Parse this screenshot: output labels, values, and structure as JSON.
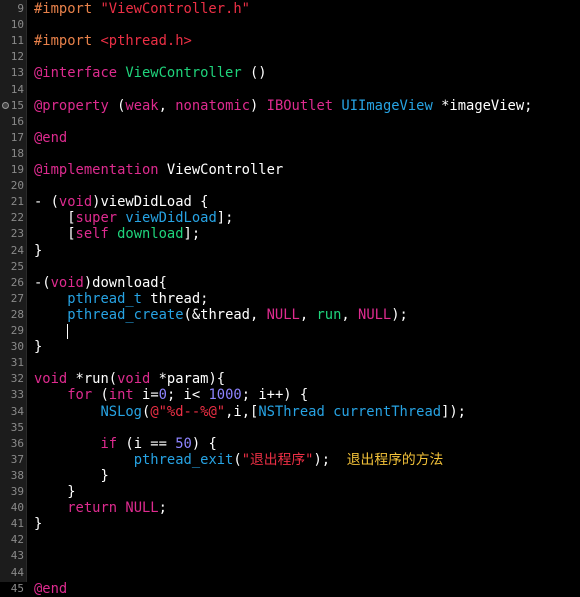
{
  "colors": {
    "keyword": "#de2b8f",
    "preprocessor": "#e8814a",
    "string": "#ec2f45",
    "class": "#1fd47c",
    "type": "#27a3e3",
    "number": "#8e84ff",
    "comment": "#f3c239",
    "background": "#000000"
  },
  "breakpoint_line": 15,
  "caret_line": 29,
  "lines": [
    {
      "n": "9",
      "t": [
        [
          "#import ",
          "pp"
        ],
        [
          "\"ViewController.h\"",
          "s"
        ]
      ]
    },
    {
      "n": "10",
      "t": []
    },
    {
      "n": "11",
      "t": [
        [
          "#import ",
          "pp"
        ],
        [
          "<pthread.h>",
          "s"
        ]
      ]
    },
    {
      "n": "12",
      "t": []
    },
    {
      "n": "13",
      "t": [
        [
          "@interface ",
          "k"
        ],
        [
          "ViewController",
          "c"
        ],
        [
          " ()",
          "p"
        ]
      ]
    },
    {
      "n": "14",
      "t": []
    },
    {
      "n": "15",
      "t": [
        [
          "@property",
          "k"
        ],
        [
          " (",
          "p"
        ],
        [
          "weak",
          "k"
        ],
        [
          ", ",
          "p"
        ],
        [
          "nonatomic",
          "k"
        ],
        [
          ") ",
          "p"
        ],
        [
          "IBOutlet ",
          "k"
        ],
        [
          "UIImageView",
          "t"
        ],
        [
          " *imageView;",
          "p"
        ]
      ]
    },
    {
      "n": "16",
      "t": []
    },
    {
      "n": "17",
      "t": [
        [
          "@end",
          "k"
        ]
      ]
    },
    {
      "n": "18",
      "t": []
    },
    {
      "n": "19",
      "t": [
        [
          "@implementation",
          "k"
        ],
        [
          " ViewController",
          "p"
        ]
      ]
    },
    {
      "n": "20",
      "t": []
    },
    {
      "n": "21",
      "t": [
        [
          "- (",
          "p"
        ],
        [
          "void",
          "k"
        ],
        [
          ")viewDidLoad {",
          "p"
        ]
      ]
    },
    {
      "n": "22",
      "t": [
        [
          "    [",
          "p"
        ],
        [
          "super",
          "k"
        ],
        [
          " ",
          "p"
        ],
        [
          "viewDidLoad",
          "t"
        ],
        [
          "];",
          "p"
        ]
      ]
    },
    {
      "n": "23",
      "t": [
        [
          "    [",
          "p"
        ],
        [
          "self",
          "k"
        ],
        [
          " ",
          "p"
        ],
        [
          "download",
          "g"
        ],
        [
          "];",
          "p"
        ]
      ]
    },
    {
      "n": "24",
      "t": [
        [
          "}",
          "p"
        ]
      ]
    },
    {
      "n": "25",
      "t": []
    },
    {
      "n": "26",
      "t": [
        [
          "-(",
          "p"
        ],
        [
          "void",
          "k"
        ],
        [
          ")download{",
          "p"
        ]
      ]
    },
    {
      "n": "27",
      "t": [
        [
          "    ",
          "p"
        ],
        [
          "pthread_t",
          "t"
        ],
        [
          " thread;",
          "p"
        ]
      ]
    },
    {
      "n": "28",
      "t": [
        [
          "    ",
          "p"
        ],
        [
          "pthread_create",
          "t"
        ],
        [
          "(&thread, ",
          "p"
        ],
        [
          "NULL",
          "k"
        ],
        [
          ", ",
          "p"
        ],
        [
          "run",
          "g"
        ],
        [
          ", ",
          "p"
        ],
        [
          "NULL",
          "k"
        ],
        [
          ");",
          "p"
        ]
      ]
    },
    {
      "n": "29",
      "t": [
        [
          "    ",
          "p"
        ]
      ]
    },
    {
      "n": "30",
      "t": [
        [
          "}",
          "p"
        ]
      ]
    },
    {
      "n": "31",
      "t": []
    },
    {
      "n": "32",
      "t": [
        [
          "void",
          "k"
        ],
        [
          " *run(",
          "p"
        ],
        [
          "void",
          "k"
        ],
        [
          " *param){",
          "p"
        ]
      ]
    },
    {
      "n": "33",
      "t": [
        [
          "    ",
          "p"
        ],
        [
          "for",
          "k"
        ],
        [
          " (",
          "p"
        ],
        [
          "int",
          "k"
        ],
        [
          " i=",
          "p"
        ],
        [
          "0",
          "n"
        ],
        [
          "; i< ",
          "p"
        ],
        [
          "1000",
          "n"
        ],
        [
          "; i++) {",
          "p"
        ]
      ]
    },
    {
      "n": "34",
      "t": [
        [
          "        ",
          "p"
        ],
        [
          "NSLog",
          "t"
        ],
        [
          "(",
          "p"
        ],
        [
          "@\"%d--%@\"",
          "s"
        ],
        [
          ",i,[",
          "p"
        ],
        [
          "NSThread",
          "t"
        ],
        [
          " ",
          "p"
        ],
        [
          "currentThread",
          "t"
        ],
        [
          "]);",
          "p"
        ]
      ]
    },
    {
      "n": "35",
      "t": []
    },
    {
      "n": "36",
      "t": [
        [
          "        ",
          "p"
        ],
        [
          "if",
          "k"
        ],
        [
          " (i == ",
          "p"
        ],
        [
          "50",
          "n"
        ],
        [
          ") {",
          "p"
        ]
      ]
    },
    {
      "n": "37",
      "t": [
        [
          "            ",
          "p"
        ],
        [
          "pthread_exit",
          "t"
        ],
        [
          "(",
          "p"
        ],
        [
          "\"退出程序\"",
          "s"
        ],
        [
          ");  ",
          "p"
        ],
        [
          "退出程序的方法",
          "m"
        ]
      ]
    },
    {
      "n": "38",
      "t": [
        [
          "        }",
          "p"
        ]
      ]
    },
    {
      "n": "39",
      "t": [
        [
          "    }",
          "p"
        ]
      ]
    },
    {
      "n": "40",
      "t": [
        [
          "    ",
          "p"
        ],
        [
          "return",
          "k"
        ],
        [
          " ",
          "p"
        ],
        [
          "NULL",
          "k"
        ],
        [
          ";",
          "p"
        ]
      ]
    },
    {
      "n": "41",
      "t": [
        [
          "}",
          "p"
        ]
      ]
    },
    {
      "n": "42",
      "t": []
    },
    {
      "n": "43",
      "t": []
    },
    {
      "n": "44",
      "t": []
    },
    {
      "n": "45",
      "t": [
        [
          "@end",
          "k"
        ]
      ]
    }
  ]
}
